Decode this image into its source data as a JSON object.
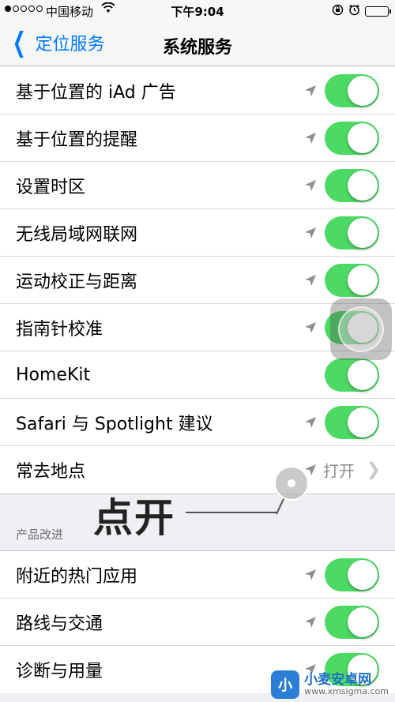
{
  "status_bar": {
    "carrier": "中国移动",
    "time": "下午9:04"
  },
  "nav": {
    "back_label": "定位服务",
    "title": "系统服务"
  },
  "rows": [
    {
      "label": "基于位置的 iAd 广告",
      "arrow": true,
      "toggle_on": true
    },
    {
      "label": "基于位置的提醒",
      "arrow": true,
      "toggle_on": true
    },
    {
      "label": "设置时区",
      "arrow": true,
      "toggle_on": true
    },
    {
      "label": "无线局域网联网",
      "arrow": true,
      "toggle_on": true
    },
    {
      "label": "运动校正与距离",
      "arrow": true,
      "toggle_on": true
    },
    {
      "label": "指南针校准",
      "arrow": true,
      "toggle_on": true
    },
    {
      "label": "HomeKit",
      "arrow": false,
      "toggle_on": true
    },
    {
      "label": "Safari 与 Spotlight 建议",
      "arrow": true,
      "toggle_on": true
    },
    {
      "label": "常去地点",
      "arrow": true,
      "value": "打开"
    }
  ],
  "section_header": "产品改进",
  "rows2": [
    {
      "label": "附近的热门应用",
      "arrow": true,
      "toggle_on": true
    },
    {
      "label": "路线与交通",
      "arrow": true,
      "toggle_on": true
    },
    {
      "label": "诊断与用量",
      "arrow": true,
      "toggle_on": true
    }
  ],
  "annotation": "点开",
  "watermark": {
    "logo_text": "小",
    "title": "小麦安卓网",
    "url": "www.xmsigma.com"
  },
  "colors": {
    "accent": "#007aff",
    "toggle_on": "#4cd964",
    "background": "#efeff4"
  }
}
